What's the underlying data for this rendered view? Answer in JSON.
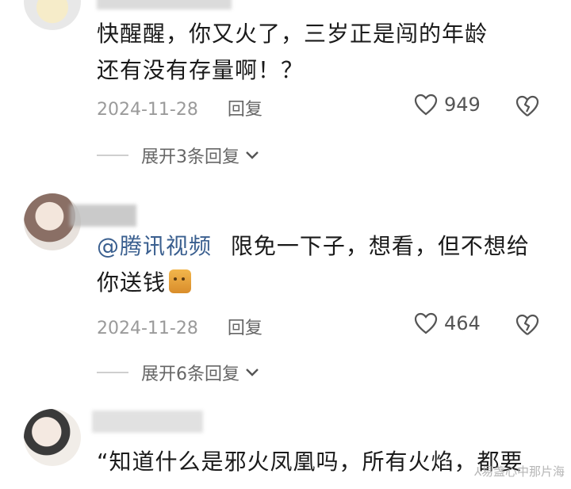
{
  "comments": [
    {
      "text_line1": "快醒醒，你又火了，三岁正是闯的年龄",
      "text_line2": "还有没有存量啊！？",
      "date": "2024-11-28",
      "reply_label": "回复",
      "likes": "949",
      "expand_label": "展开3条回复"
    },
    {
      "mention": "@腾讯视频",
      "text_line1": "限免一下子，想看，但不想给",
      "text_line2": "你送钱",
      "date": "2024-11-28",
      "reply_label": "回复",
      "likes": "464",
      "expand_label": "展开6条回复"
    },
    {
      "text_line1": "“知道什么是邪火凤凰吗，所有火焰，都要"
    }
  ],
  "watermark": "⅄易盏心中那片海",
  "colors": {
    "mention": "#3a5f8f",
    "meta": "#9a9a9a",
    "background": "#ffffff"
  }
}
